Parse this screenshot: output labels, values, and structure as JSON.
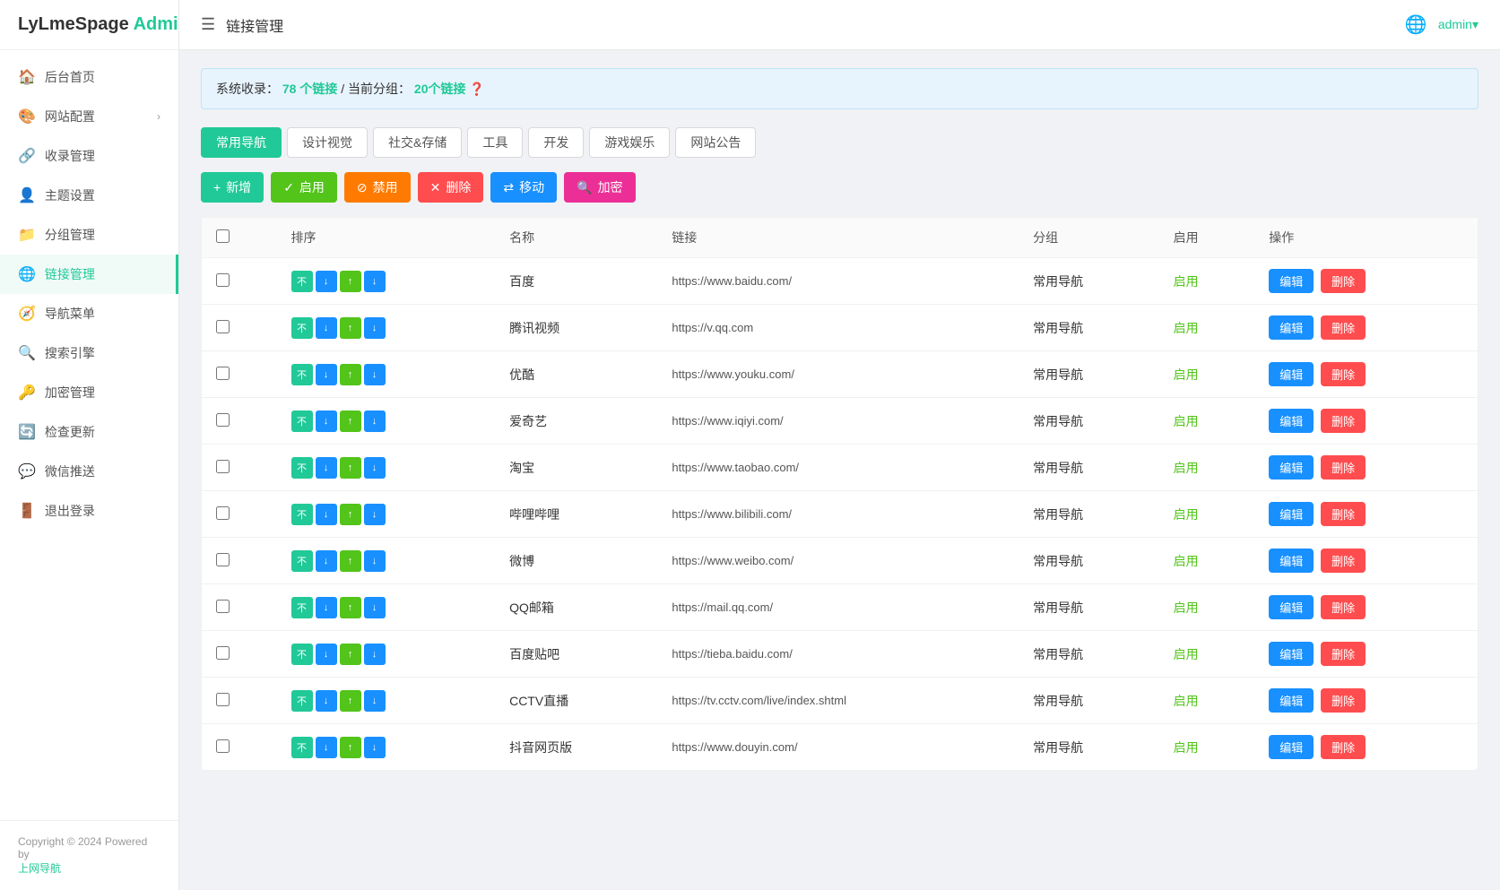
{
  "logo": {
    "ly": "LyLme",
    "spage": "Spage",
    "admin": "Admin"
  },
  "header": {
    "menu_icon": "☰",
    "title": "链接管理",
    "admin_label": "admin▾"
  },
  "sidebar": {
    "items": [
      {
        "id": "home",
        "icon": "🏠",
        "label": "后台首页",
        "active": false,
        "arrow": false
      },
      {
        "id": "site-config",
        "icon": "🎨",
        "label": "网站配置",
        "active": false,
        "arrow": true
      },
      {
        "id": "collect",
        "icon": "🔗",
        "label": "收录管理",
        "active": false,
        "arrow": false
      },
      {
        "id": "theme",
        "icon": "👤",
        "label": "主题设置",
        "active": false,
        "arrow": false
      },
      {
        "id": "group",
        "icon": "📁",
        "label": "分组管理",
        "active": false,
        "arrow": false
      },
      {
        "id": "link",
        "icon": "🌐",
        "label": "链接管理",
        "active": true,
        "arrow": false
      },
      {
        "id": "nav-menu",
        "icon": "🧭",
        "label": "导航菜单",
        "active": false,
        "arrow": false
      },
      {
        "id": "search",
        "icon": "🔍",
        "label": "搜索引擎",
        "active": false,
        "arrow": false
      },
      {
        "id": "encrypt",
        "icon": "🔑",
        "label": "加密管理",
        "active": false,
        "arrow": false
      },
      {
        "id": "update",
        "icon": "🔄",
        "label": "检查更新",
        "active": false,
        "arrow": false
      },
      {
        "id": "wechat",
        "icon": "💬",
        "label": "微信推送",
        "active": false,
        "arrow": false
      },
      {
        "id": "logout",
        "icon": "🚪",
        "label": "退出登录",
        "active": false,
        "arrow": false
      }
    ],
    "footer": {
      "copyright": "Copyright © 2024 Powered by",
      "link_label": "上网导航",
      "link_url": "#"
    }
  },
  "info_bar": {
    "prefix": "系统收录：",
    "total": "78 个链接",
    "separator": " / 当前分组：",
    "current": "20个链接",
    "help_icon": "❓"
  },
  "tabs": [
    {
      "id": "nav",
      "label": "常用导航",
      "active": true
    },
    {
      "id": "design",
      "label": "设计视觉",
      "active": false
    },
    {
      "id": "social",
      "label": "社交&存储",
      "active": false
    },
    {
      "id": "tools",
      "label": "工具",
      "active": false
    },
    {
      "id": "dev",
      "label": "开发",
      "active": false
    },
    {
      "id": "game",
      "label": "游戏娱乐",
      "active": false
    },
    {
      "id": "announce",
      "label": "网站公告",
      "active": false
    }
  ],
  "actions": [
    {
      "id": "add",
      "icon": "+",
      "label": "新增",
      "class": "btn-add"
    },
    {
      "id": "enable",
      "icon": "✓",
      "label": "启用",
      "class": "btn-enable"
    },
    {
      "id": "disable",
      "icon": "⊘",
      "label": "禁用",
      "class": "btn-disable"
    },
    {
      "id": "delete",
      "icon": "✕",
      "label": "删除",
      "class": "btn-delete"
    },
    {
      "id": "move",
      "icon": "⇄",
      "label": "移动",
      "class": "btn-move"
    },
    {
      "id": "encrypt",
      "icon": "🔍",
      "label": "加密",
      "class": "btn-encrypt"
    }
  ],
  "table": {
    "columns": [
      "",
      "排序",
      "名称",
      "链接",
      "分组",
      "启用",
      "操作"
    ],
    "rows": [
      {
        "id": 1,
        "name": "百度",
        "url": "https://www.baidu.com/",
        "group": "常用导航",
        "enabled": true
      },
      {
        "id": 2,
        "name": "腾讯视频",
        "url": "https://v.qq.com",
        "group": "常用导航",
        "enabled": true
      },
      {
        "id": 3,
        "name": "优酷",
        "url": "https://www.youku.com/",
        "group": "常用导航",
        "enabled": true
      },
      {
        "id": 4,
        "name": "爱奇艺",
        "url": "https://www.iqiyi.com/",
        "group": "常用导航",
        "enabled": true
      },
      {
        "id": 5,
        "name": "淘宝",
        "url": "https://www.taobao.com/",
        "group": "常用导航",
        "enabled": true
      },
      {
        "id": 6,
        "name": "哔哩哔哩",
        "url": "https://www.bilibili.com/",
        "group": "常用导航",
        "enabled": true
      },
      {
        "id": 7,
        "name": "微博",
        "url": "https://www.weibo.com/",
        "group": "常用导航",
        "enabled": true
      },
      {
        "id": 8,
        "name": "QQ邮箱",
        "url": "https://mail.qq.com/",
        "group": "常用导航",
        "enabled": true
      },
      {
        "id": 9,
        "name": "百度贴吧",
        "url": "https://tieba.baidu.com/",
        "group": "常用导航",
        "enabled": true
      },
      {
        "id": 10,
        "name": "CCTV直播",
        "url": "https://tv.cctv.com/live/index.shtml",
        "group": "常用导航",
        "enabled": true
      },
      {
        "id": 11,
        "name": "抖音网页版",
        "url": "https://www.douyin.com/",
        "group": "常用导航",
        "enabled": true
      }
    ],
    "enabled_label": "启用",
    "edit_label": "编辑",
    "delete_label": "删除"
  }
}
